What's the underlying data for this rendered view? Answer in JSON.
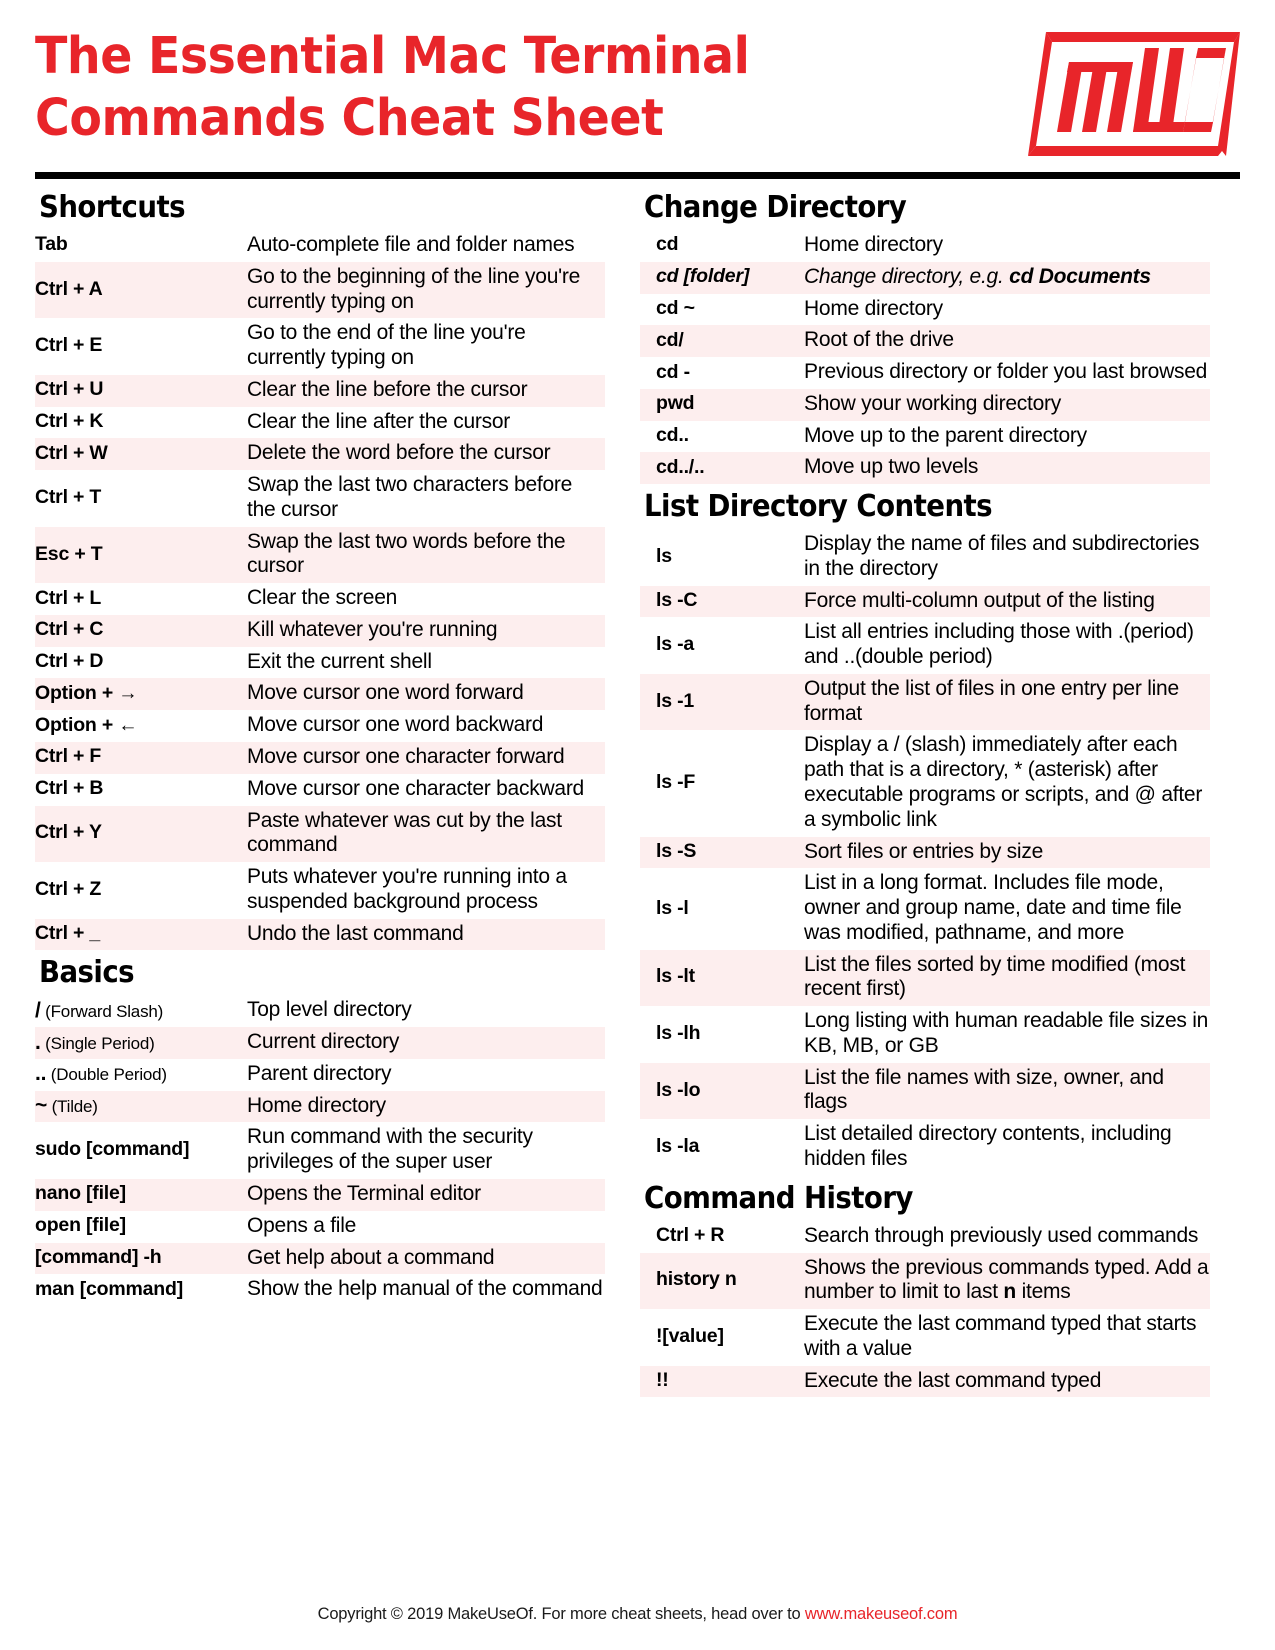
{
  "header": {
    "title_line1": "The Essential Mac Terminal",
    "title_line2": "Commands Cheat Sheet",
    "logo_name": "MUO",
    "brand_color": "#e8252a"
  },
  "sections": {
    "shortcuts": {
      "heading": "Shortcuts",
      "rows": [
        {
          "key": "Tab",
          "value": "Auto-complete file and folder names"
        },
        {
          "key": "Ctrl + A",
          "value": "Go to the beginning of the line you're currently typing on"
        },
        {
          "key": "Ctrl + E",
          "value": "Go to the end of the line you're currently typing on"
        },
        {
          "key": "Ctrl + U",
          "value": "Clear the line before the cursor"
        },
        {
          "key": "Ctrl + K",
          "value": "Clear the line after the cursor"
        },
        {
          "key": "Ctrl + W",
          "value": "Delete the word before the cursor"
        },
        {
          "key": "Ctrl + T",
          "value": "Swap the last two characters before the cursor"
        },
        {
          "key": "Esc + T",
          "value": "Swap the last two words before the cursor"
        },
        {
          "key": "Ctrl + L",
          "value": "Clear the screen"
        },
        {
          "key": "Ctrl + C",
          "value": "Kill whatever you're running"
        },
        {
          "key": "Ctrl + D",
          "value": "Exit the current shell"
        },
        {
          "key": "Option + →",
          "value": "Move cursor one word forward"
        },
        {
          "key": "Option + ←",
          "value": "Move cursor one word backward"
        },
        {
          "key": "Ctrl + F",
          "value": "Move cursor one character forward"
        },
        {
          "key": "Ctrl + B",
          "value": "Move cursor one character backward"
        },
        {
          "key": "Ctrl + Y",
          "value": "Paste whatever was cut by the last command"
        },
        {
          "key": "Ctrl + Z",
          "value": "Puts whatever you're running into a suspended background process"
        },
        {
          "key": "Ctrl + _",
          "value": "Undo the last command"
        }
      ]
    },
    "basics": {
      "heading": "Basics",
      "rows": [
        {
          "sym": "/",
          "note": "(Forward Slash)",
          "value": "Top level directory"
        },
        {
          "sym": ".",
          "note": "(Single Period)",
          "value": "Current directory"
        },
        {
          "sym": "..",
          "note": "(Double Period)",
          "value": "Parent directory"
        },
        {
          "sym": "~",
          "note": "(Tilde)",
          "value": "Home directory"
        },
        {
          "key": "sudo [command]",
          "value": "Run command with the security privileges of the super user"
        },
        {
          "key": "nano [file]",
          "value": "Opens the Terminal editor"
        },
        {
          "key": "open [file]",
          "value": "Opens a file"
        },
        {
          "key": "[command] -h",
          "value": "Get help about a command"
        },
        {
          "key": "man [command]",
          "value": "Show the help manual of the command"
        }
      ]
    },
    "change_directory": {
      "heading": "Change Directory",
      "rows": [
        {
          "key": "cd",
          "value": "Home directory"
        },
        {
          "key": "cd [folder]",
          "value_pre": "Change directory, e.g. ",
          "value_bold": "cd Documents",
          "value": "Change directory, e.g. cd Documents",
          "italic": true
        },
        {
          "key": "cd ~",
          "value": "Home directory"
        },
        {
          "key": "cd/",
          "value": "Root of the drive"
        },
        {
          "key": "cd -",
          "value": "Previous directory or folder you last browsed"
        },
        {
          "key": "pwd",
          "value": "Show your working directory"
        },
        {
          "key": "cd..",
          "value": "Move up to the parent directory"
        },
        {
          "key": "cd../..",
          "value": "Move up two levels"
        }
      ]
    },
    "list_directory_contents": {
      "heading": "List Directory Contents",
      "rows": [
        {
          "key": "ls",
          "value": "Display the name of files and subdirectories in the directory"
        },
        {
          "key": "ls -C",
          "value": "Force multi-column output of the listing"
        },
        {
          "key": "ls -a",
          "value": "List all entries including those with .(period) and ..(double period)"
        },
        {
          "key": "ls -1",
          "value": "Output the list of files in one entry per line format"
        },
        {
          "key": "ls -F",
          "value": "Display a / (slash) immediately after each path that is a directory, * (asterisk) after executable programs or scripts, and @ after a symbolic link"
        },
        {
          "key": "ls -S",
          "value": "Sort files or entries by size"
        },
        {
          "key": "ls -l",
          "value": "List in a long format. Includes file mode, owner and group name, date and time file was modified, pathname, and more"
        },
        {
          "key": "ls -lt",
          "value": "List the files sorted by time modified (most recent first)"
        },
        {
          "key": "ls -lh",
          "value": "Long listing with human readable file sizes in KB, MB, or GB"
        },
        {
          "key": "ls -lo",
          "value": "List the file names with size, owner, and flags"
        },
        {
          "key": "ls -la",
          "value": "List detailed directory contents, including hidden files"
        }
      ]
    },
    "command_history": {
      "heading": "Command History",
      "rows": [
        {
          "key": "Ctrl + R",
          "value": "Search through previously used commands"
        },
        {
          "key": "history n",
          "value_pre": "Shows the previous commands typed. Add a number to limit to last ",
          "value_bold": "n",
          "value_post": " items",
          "value": "Shows the previous commands typed. Add a number to limit to last n items"
        },
        {
          "key": "![value]",
          "value": "Execute the last command typed that starts with a value"
        },
        {
          "key": "!!",
          "value": "Execute the last command typed"
        }
      ]
    }
  },
  "footer": {
    "text": "Copyright © 2019 MakeUseOf. For more cheat sheets, head over to ",
    "link": "www.makeuseof.com"
  }
}
